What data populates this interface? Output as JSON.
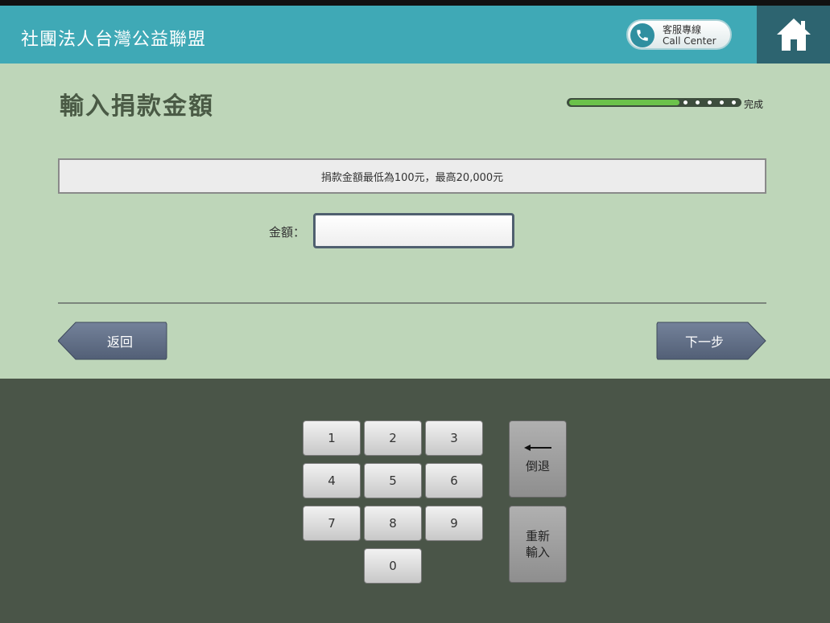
{
  "header": {
    "org_name": "社團法人台灣公益聯盟",
    "call_center_line1": "客服專線",
    "call_center_line2": "Call Center",
    "home_icon": "home-icon"
  },
  "page": {
    "title": "輸入捐款金額",
    "progress_label": "完成",
    "progress": 0.65,
    "progress_steps": 6
  },
  "form": {
    "notice": "捐款金額最低為100元，最高20,000元",
    "amount_label": "金額：",
    "amount_value": ""
  },
  "nav": {
    "back_label": "返回",
    "next_label": "下一步"
  },
  "keypad": {
    "keys": [
      "1",
      "2",
      "3",
      "4",
      "5",
      "6",
      "7",
      "8",
      "9",
      "0"
    ],
    "backspace_label": "倒退",
    "reset_label_line1": "重新",
    "reset_label_line2": "輸入"
  },
  "colors": {
    "header": "#3fa9b6",
    "home_bg": "#2d6470",
    "main_bg": "#bed6b9",
    "keypad_bg": "#4a5548",
    "nav_button": "#5f6e86",
    "progress_fill": "#6bc24a"
  }
}
